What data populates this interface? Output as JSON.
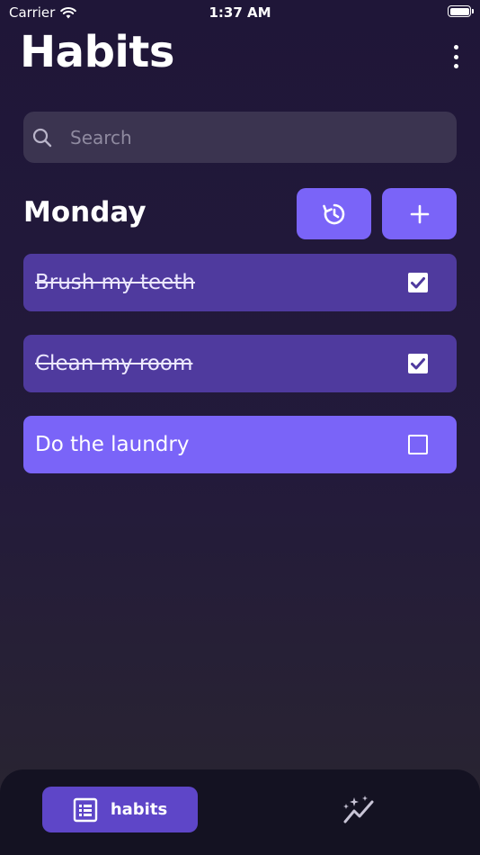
{
  "status_bar": {
    "carrier": "Carrier",
    "time": "1:37 AM"
  },
  "header": {
    "title": "Habits"
  },
  "search": {
    "placeholder": "Search"
  },
  "day": {
    "label": "Monday"
  },
  "habits": [
    {
      "label": "Brush my teeth",
      "done": true
    },
    {
      "label": "Clean my room",
      "done": true
    },
    {
      "label": "Do the laundry",
      "done": false
    }
  ],
  "tab_bar": {
    "habits_label": "habits"
  },
  "colors": {
    "accent": "#7a64f8",
    "done_item": "#4f3a9e",
    "tab_active": "#5e46c8",
    "search_bg": "#3b3450",
    "tab_bar_bg": "#141222"
  },
  "icons": {
    "menu": "more-vertical-icon",
    "search": "search-icon",
    "reset": "history-reset-icon",
    "add": "plus-icon",
    "habits_tab": "list-icon",
    "stats_tab": "sparkle-trend-icon"
  }
}
